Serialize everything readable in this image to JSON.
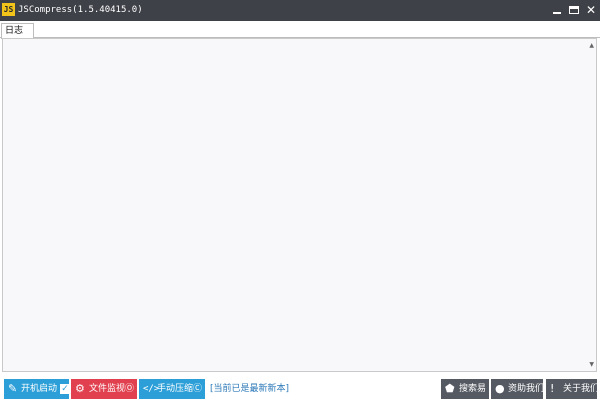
{
  "window": {
    "icon_text": "JS",
    "title": "JSCompress(1.5.40415.0)",
    "minimize_icon": "minimize-icon",
    "maximize_icon": "maximize-icon",
    "close_icon": "close-icon",
    "close_glyph": "✕"
  },
  "tabs": [
    {
      "label": "日志",
      "active": true
    }
  ],
  "log": {
    "lines": []
  },
  "toolbar": {
    "startup": {
      "label": "开机启动",
      "icon": "pin-icon",
      "glyph": "✎",
      "checked": true,
      "check_glyph": "✓"
    },
    "monitor": {
      "label": "文件监视Ⓞ",
      "icon": "gear-icon",
      "glyph": "⚙"
    },
    "compress": {
      "label": "手动压缩Ⓒ",
      "icon": "code-icon",
      "glyph": "</>"
    },
    "status": "[当前已是最新新本]",
    "search": {
      "label": "搜索易",
      "icon": "tag-icon",
      "glyph": "⬟"
    },
    "donate": {
      "label": "资助我们",
      "icon": "drop-icon",
      "glyph": "●"
    },
    "about": {
      "label": "关于我们",
      "icon": "info-icon",
      "glyph": "!"
    }
  },
  "colors": {
    "titlebar": "#3f4148",
    "accent_blue": "#2d9fd8",
    "accent_red": "#e1404f",
    "dark_button": "#555962",
    "status_text": "#2d79b8"
  }
}
